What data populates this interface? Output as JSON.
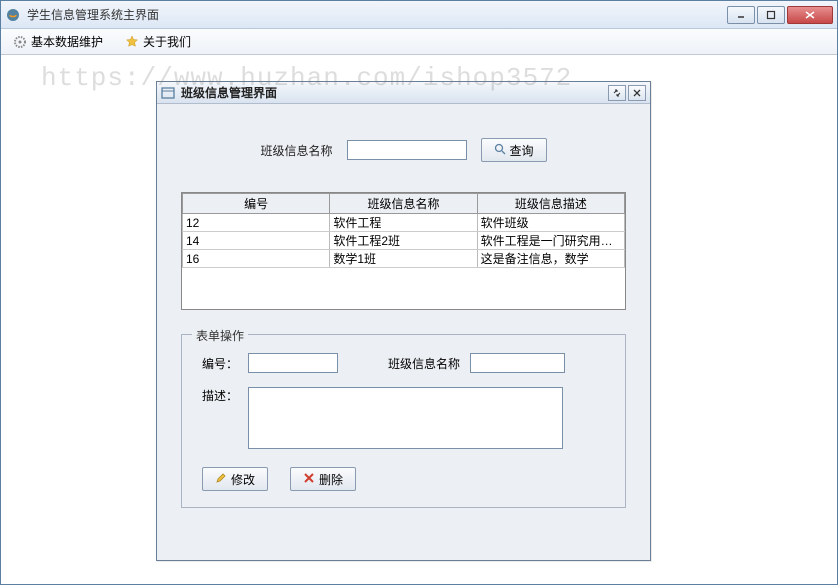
{
  "window": {
    "title": "学生信息管理系统主界面"
  },
  "menu": {
    "basic_data": "基本数据维护",
    "about": "关于我们"
  },
  "watermark": "https://www.huzhan.com/ishop3572",
  "internal": {
    "title": "班级信息管理界面"
  },
  "search": {
    "label": "班级信息名称",
    "value": "",
    "button": "查询"
  },
  "table": {
    "headers": [
      "编号",
      "班级信息名称",
      "班级信息描述"
    ],
    "rows": [
      {
        "id": "12",
        "name": "软件工程",
        "desc": "软件班级"
      },
      {
        "id": "14",
        "name": "软件工程2班",
        "desc": "软件工程是一门研究用工程..."
      },
      {
        "id": "16",
        "name": "数学1班",
        "desc": "这是备注信息，数学"
      }
    ]
  },
  "form": {
    "legend": "表单操作",
    "id_label": "编号：",
    "id_value": "",
    "name_label": "班级信息名称",
    "name_value": "",
    "desc_label": "描述：",
    "desc_value": "",
    "modify_button": "修改",
    "delete_button": "删除"
  }
}
